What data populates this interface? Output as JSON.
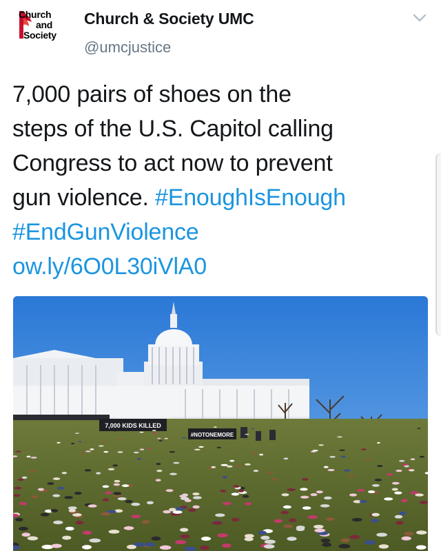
{
  "account": {
    "logo_lines": [
      "Church",
      "and",
      "Society"
    ],
    "display_name": "Church & Society UMC",
    "handle": "@umcjustice"
  },
  "tweet": {
    "lines": [
      "7,000 pairs of shoes on the",
      "steps of the U.S. Capitol calling",
      "Congress to act now to prevent",
      "gun violence. "
    ],
    "hashtag1": "#EnoughIsEnough",
    "hashtag2": "#EndGunViolence",
    "link": "ow.ly/6O0L30iVlA0"
  },
  "media": {
    "banner_left": "7,000 KIDS KILLED",
    "banner_right": "#NOTONEMORE"
  },
  "colors": {
    "link": "#1b95e0",
    "text": "#14171a",
    "secondary": "#657786",
    "sky": "#2f7ed8",
    "grass": "#5b6b2e"
  }
}
